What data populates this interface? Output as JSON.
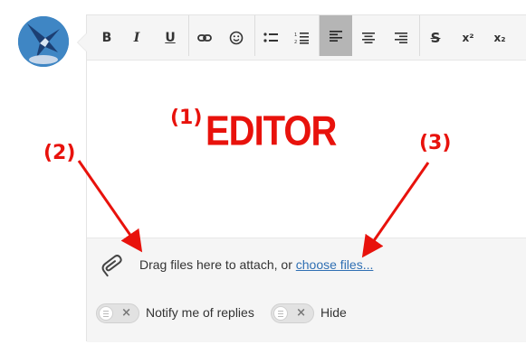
{
  "avatar": {
    "icon": "eagle-logo-icon"
  },
  "toolbar": {
    "bold": "B",
    "italic": "I",
    "underline": "U",
    "strike": "S",
    "superscript": "x²",
    "subscript": "x₂"
  },
  "attach": {
    "text": "Drag files here to attach, or ",
    "link": "choose files..."
  },
  "toggles": [
    {
      "label": "Notify me of replies",
      "mark": "×"
    },
    {
      "label": "Hide",
      "mark": "×"
    }
  ],
  "annotations": {
    "one": "(1)",
    "editor": "EDITOR",
    "two": "(2)",
    "three": "(3)",
    "color": "#e8120c"
  }
}
